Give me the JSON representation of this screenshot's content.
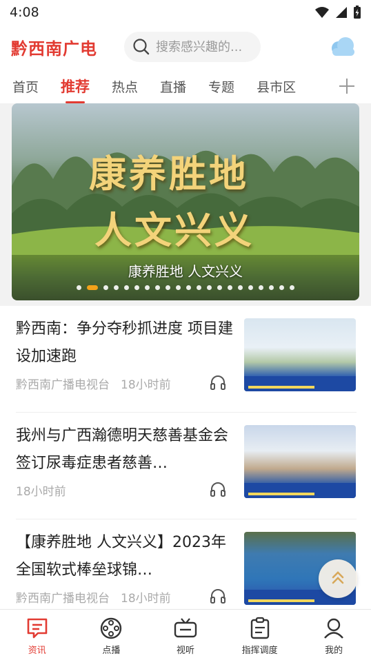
{
  "status_bar": {
    "time": "4:08"
  },
  "header": {
    "logo": "黔西南广电",
    "search_placeholder": "搜索感兴趣的...",
    "weather_icon": "cloud-icon"
  },
  "tabs": {
    "items": [
      {
        "label": "首页",
        "active": false
      },
      {
        "label": "推荐",
        "active": true
      },
      {
        "label": "热点",
        "active": false
      },
      {
        "label": "直播",
        "active": false
      },
      {
        "label": "专题",
        "active": false
      },
      {
        "label": "县市区",
        "active": false
      }
    ],
    "add_icon": "plus-icon"
  },
  "banner": {
    "art_line1": "康养胜地",
    "art_line2": "人文兴义",
    "caption": "康养胜地 人文兴义",
    "total_slides": 21,
    "active_slide": 1
  },
  "news": [
    {
      "title": "黔西南：争分夺秒抓进度 项目建设加速跑",
      "source": "黔西南广播电视台",
      "time": "18小时前"
    },
    {
      "title": "我州与广西瀚德明天慈善基金会签订尿毒症患者慈善…",
      "source": "",
      "time": "18小时前"
    },
    {
      "title": "【康养胜地 人文兴义】2023年全国软式棒垒球锦…",
      "source": "黔西南广播电视台",
      "time": "18小时前"
    }
  ],
  "bottom_nav": [
    {
      "label": "资讯",
      "icon": "news-chat-icon",
      "active": true
    },
    {
      "label": "点播",
      "icon": "film-reel-icon",
      "active": false
    },
    {
      "label": "视听",
      "icon": "tv-icon",
      "active": false
    },
    {
      "label": "指挥调度",
      "icon": "clipboard-icon",
      "active": false
    },
    {
      "label": "我的",
      "icon": "user-icon",
      "active": false
    }
  ],
  "colors": {
    "accent": "#e23b32",
    "dot_active": "#f2a21a"
  }
}
